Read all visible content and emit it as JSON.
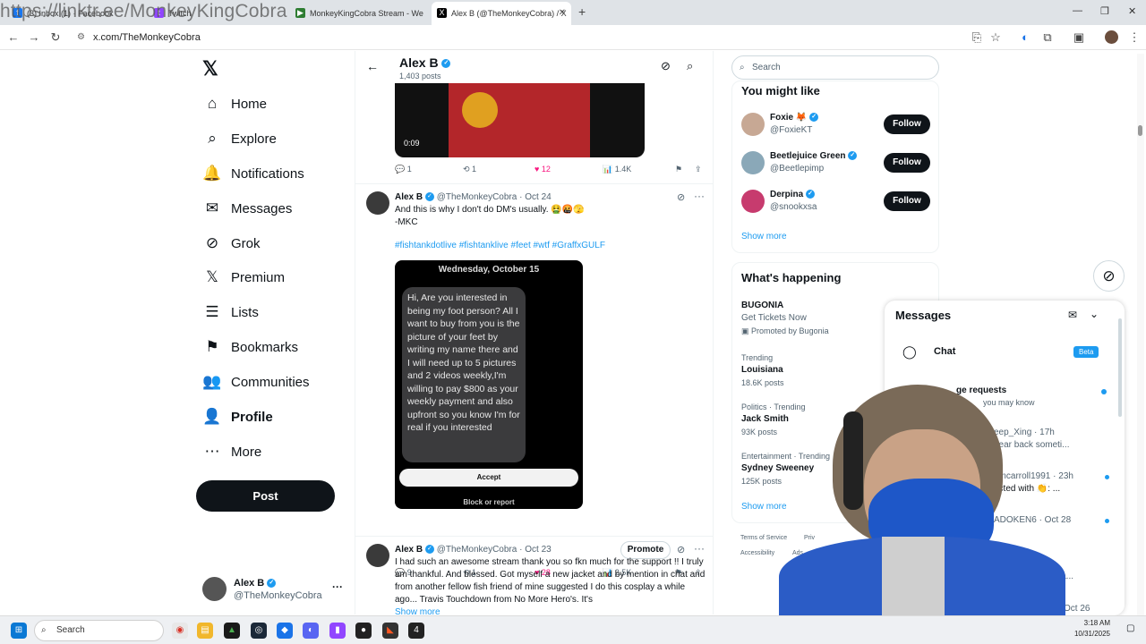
{
  "browser": {
    "watermark": "https://linktr.ee/MonkeyKingCobra",
    "tabs": [
      {
        "label": "(3) Inbox (1) · Facebook"
      },
      {
        "label": "Twitch"
      },
      {
        "label": "MonkeyKingCobra Stream - We"
      },
      {
        "label": "Alex B (@TheMonkeyCobra) / X"
      }
    ],
    "new_tab": "+",
    "url": "x.com/TheMonkeyCobra",
    "win_controls": [
      "—",
      "❐",
      "✕"
    ]
  },
  "nav": {
    "logo": "𝕏",
    "items": [
      {
        "label": "Home",
        "icon": "⌂"
      },
      {
        "label": "Explore",
        "icon": "⌕"
      },
      {
        "label": "Notifications",
        "icon": "🔔"
      },
      {
        "label": "Messages",
        "icon": "✉"
      },
      {
        "label": "Grok",
        "icon": "⊘"
      },
      {
        "label": "Premium",
        "icon": "𝕏"
      },
      {
        "label": "Lists",
        "icon": "☰"
      },
      {
        "label": "Bookmarks",
        "icon": "⚑"
      },
      {
        "label": "Communities",
        "icon": "👥"
      },
      {
        "label": "Profile",
        "icon": "👤"
      },
      {
        "label": "More",
        "icon": "⋯"
      }
    ],
    "post": "Post",
    "account": {
      "name": "Alex B",
      "handle": "@TheMonkeyCobra",
      "more": "···"
    }
  },
  "profile_header": {
    "name": "Alex B",
    "posts": "1,403 posts",
    "back": "←"
  },
  "video": {
    "time": "0:09"
  },
  "tweet0_actions": {
    "reply": "1",
    "retweet": "1",
    "like": "12",
    "views": "1.4K"
  },
  "tweet1": {
    "name": "Alex B",
    "handle": "@TheMonkeyCobra",
    "dot": "·",
    "date": "Oct 24",
    "line1": "And this is why I don't do DM's usually. 🤮🤬🫣",
    "line2": "-MKC",
    "tags": "#fishtankdotlive #fishtanklive #feet #wtf #GraffxGULF",
    "img_date": "Wednesday, October 15",
    "img_msg": "Hi, Are you interested in being my foot person? All I want to buy from you is the picture of your feet by writing my name there  and I will need up to 5 pictures and 2 videos weekly,I'm willing to pay $800 as your weekly payment and also upfront so you know I'm for real if you interested",
    "accept": "Accept",
    "block": "Block or report",
    "actions": {
      "reply": "9",
      "retweet": "1",
      "like": "28",
      "views": "2.5K"
    }
  },
  "tweet2": {
    "name": "Alex B",
    "handle": "@TheMonkeyCobra",
    "dot": "·",
    "date": "Oct 23",
    "promote": "Promote",
    "text": "I had such an awesome stream thank you so fkn much for the support !! I truly am thankful. And blessed. Got myself a new jacket and by mention in chat and from another fellow fish friend of mine suggested I do this cosplay a while ago... Travis Touchdown from No More Hero's. It's",
    "more": "Show more"
  },
  "search": {
    "placeholder": "Search"
  },
  "you_might_like": {
    "title": "You might like",
    "users": [
      {
        "name": "Foxie 🦊",
        "handle": "@FoxieKT",
        "btn": "Follow"
      },
      {
        "name": "Beetlejuice Green",
        "handle": "@Beetlepimp",
        "btn": "Follow"
      },
      {
        "name": "Derpina",
        "handle": "@snookxsa",
        "btn": "Follow"
      }
    ],
    "show_more": "Show more"
  },
  "happening": {
    "title": "What's happening",
    "items": [
      {
        "ctx": "",
        "topic": "BUGONIA",
        "sub": "Get Tickets Now",
        "meta": "Promoted by Bugonia"
      },
      {
        "ctx": "Trending",
        "topic": "Louisiana",
        "sub": "",
        "meta": "18.6K posts"
      },
      {
        "ctx": "Politics · Trending",
        "topic": "Jack Smith",
        "sub": "",
        "meta": "93K posts"
      },
      {
        "ctx": "Entertainment · Trending",
        "topic": "Sydney Sweeney",
        "sub": "",
        "meta": "125K posts"
      }
    ],
    "show_more": "Show more"
  },
  "footer": {
    "l1": "Terms of Service",
    "l2": "Priv",
    "l3": "Accessibility",
    "l4": "Ads"
  },
  "messages": {
    "title": "Messages",
    "chat": "Chat",
    "beta": "Beta",
    "req": "ge requests",
    "req_sub": "you may know",
    "c1": "eep_Xing · 17h",
    "c1s": "hear back someti...",
    "c2": "omcarroll1991 · 23h",
    "c2s": "acted with 👏: ...",
    "c3": "ADOKEN6 · Oct 28",
    "c4": "26",
    "c4s": "life ha...",
    "c5": "Oct 26"
  },
  "taskbar": {
    "search": "Search",
    "time": "3:18 AM",
    "date": "10/31/2025"
  }
}
